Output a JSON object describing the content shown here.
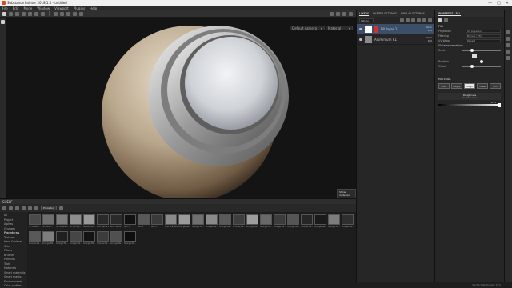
{
  "window": {
    "title": "Substance Painter 2018.1.0 - untitled",
    "minimize": "—",
    "maximize": "□",
    "close": "✕"
  },
  "menu": [
    "File",
    "Edit",
    "Mode",
    "Window",
    "Viewport",
    "Plugins",
    "Help"
  ],
  "viewport": {
    "camera_select": "Default camera",
    "view_select": "Material",
    "tooltip": "Show material"
  },
  "layers": {
    "tabs": [
      "LAYERS",
      "SHADER SETTINGS",
      "DISPLAY SETTINGS"
    ],
    "texture_set": "Sphere",
    "blend_label": "Norm",
    "opacity": "100",
    "items": [
      {
        "name": "Fill layer 1",
        "selected": true
      },
      {
        "name": "Aluminium R1",
        "selected": false
      }
    ]
  },
  "properties": {
    "title": "PROPERTIES - FILL",
    "section": "FILL",
    "projection_label": "Projection",
    "projection_value": "UV projection",
    "filtering_label": "Filtering",
    "filtering_value": "Bilinear | HQ",
    "uv_wrap_label": "UV Wrap",
    "uv_wrap_value": "Repeat",
    "uv_transform_label": "UV transformations",
    "scale_label": "Scale",
    "rotation_label": "Rotation",
    "offset_label": "Offset",
    "material_section": "MATERIAL",
    "mat_buttons": [
      "color",
      "height",
      "rough",
      "metal",
      "nrm"
    ],
    "mat_selected": "rough",
    "roughness_title": "Roughness",
    "roughness_source": "Uniform color",
    "roughness_value": "0.75"
  },
  "shelf": {
    "title": "SHELF",
    "search_tag": "Procedur.",
    "categories": [
      "All",
      "Project",
      "Alphas",
      "Grunges",
      "Procedurals",
      "Textures",
      "Hard Surfaces",
      "Skin",
      "Filters",
      "Brushes",
      "Particles",
      "Tools",
      "Materials",
      "Smart materials",
      "Smart masks",
      "Environments",
      "Color profiles"
    ],
    "selected_category": "Procedurals",
    "items": [
      {
        "label": "3D Linear...",
        "color": "#4a4a4a"
      },
      {
        "label": "3D Perlin...",
        "color": "#6e6e6e"
      },
      {
        "label": "3D Simplex...",
        "color": "#7a7a7a"
      },
      {
        "label": "3D Worley...",
        "color": "#8d8d8d"
      },
      {
        "label": "Anisotropic...",
        "color": "#999"
      },
      {
        "label": "BnW Spots 1",
        "color": "#2a2a2a"
      },
      {
        "label": "BnW Spots 2",
        "color": "#2a2a2a"
      },
      {
        "label": "Blur 1",
        "color": "#111"
      },
      {
        "label": "Blur 2",
        "color": "#585858"
      },
      {
        "label": "Blur 3",
        "color": "#3a3a3a"
      },
      {
        "label": "Bnw Gradient",
        "color": "#8a8a8a"
      },
      {
        "label": "Grunge Ma...",
        "color": "#9a9a9a"
      },
      {
        "label": "Grunge Ma...",
        "color": "#707070"
      },
      {
        "label": "Grunge Ma...",
        "color": "#8a8a8a"
      },
      {
        "label": "Grunge Ma...",
        "color": "#5a5a5a"
      },
      {
        "label": "Grunge Ma...",
        "color": "#3e3e3e"
      },
      {
        "label": "Grunge Ma...",
        "color": "#9e9e9e"
      },
      {
        "label": "Grunge Ma...",
        "color": "#686868"
      },
      {
        "label": "Grunge Ma...",
        "color": "#3c3c3c"
      },
      {
        "label": "Grunge Ma...",
        "color": "#555"
      },
      {
        "label": "Grunge Ma...",
        "color": "#262626"
      },
      {
        "label": "Grunge Ma...",
        "color": "#1a1a1a"
      },
      {
        "label": "Grunge Ma...",
        "color": "#7d7d7d"
      },
      {
        "label": "Grunge Ma...",
        "color": "#2f2f2f"
      },
      {
        "label": "Grunge Ma...",
        "color": "#595959"
      },
      {
        "label": "Grunge Ma...",
        "color": "#7e7e7e"
      },
      {
        "label": "Grunge Ma...",
        "color": "#202020"
      },
      {
        "label": "Grunge Ma...",
        "color": "#464646"
      },
      {
        "label": "Grunge Ma...",
        "color": "#141414"
      },
      {
        "label": "Grunge Ma...",
        "color": "#3c3c3c"
      },
      {
        "label": "Grunge Ma...",
        "color": "#505050"
      },
      {
        "label": "Grunge Ma...",
        "color": "#0e0e0e"
      }
    ]
  },
  "statusbar": {
    "text": "Cache Disk Usage: 14%"
  }
}
